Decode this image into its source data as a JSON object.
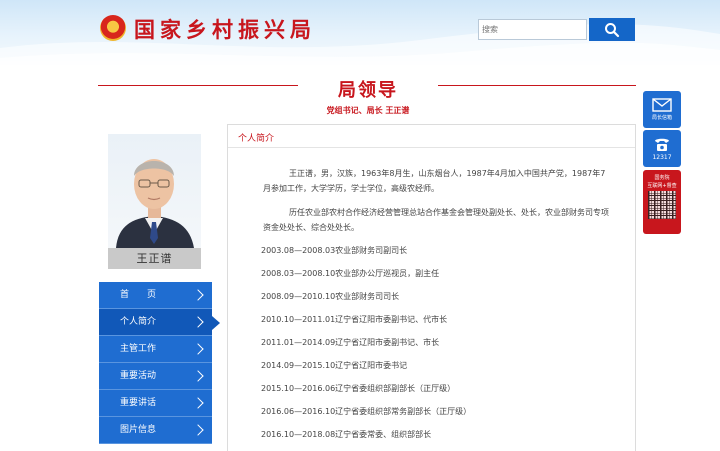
{
  "header": {
    "site_title": "国家乡村振兴局",
    "search_placeholder": "搜索"
  },
  "page": {
    "title": "局领导",
    "subtitle": "党组书记、局长 王正谱"
  },
  "leader": {
    "name": "王正谱"
  },
  "nav": {
    "items": [
      {
        "label": "首　　页"
      },
      {
        "label": "个人简介"
      },
      {
        "label": "主管工作"
      },
      {
        "label": "重要活动"
      },
      {
        "label": "重要讲话"
      },
      {
        "label": "图片信息"
      }
    ]
  },
  "content": {
    "heading": "个人简介",
    "bio_1": "王正谱，男，汉族，1963年8月生，山东烟台人，1987年4月加入中国共产党，1987年7月参加工作，大学学历，学士学位，高级农经师。",
    "bio_2": "历任农业部农村合作经济经营管理总站合作基金会管理处副处长、处长，农业部财务司专项资金处处长、综合处处长。",
    "career": [
      "2003.08—2008.03农业部财务司副司长",
      "2008.03—2008.10农业部办公厅巡视员，副主任",
      "2008.09—2010.10农业部财务司司长",
      "2010.10—2011.01辽宁省辽阳市委副书记、代市长",
      "2011.01—2014.09辽宁省辽阳市委副书记、市长",
      "2014.09—2015.10辽宁省辽阳市委书记",
      "2015.10—2016.06辽宁省委组织部副部长（正厅级）",
      "2016.06—2016.10辽宁省委组织部常务副部长（正厅级）",
      "2016.10—2018.08辽宁省委常委、组织部部长"
    ]
  },
  "float": {
    "mailbox_label": "局长信箱",
    "hotline_label": "12317",
    "qr_title": "国务院",
    "qr_subtitle": "互联网+督查"
  },
  "colors": {
    "brand_red": "#c8161d",
    "nav_blue": "#1f6dd1",
    "nav_active": "#1158b8"
  }
}
